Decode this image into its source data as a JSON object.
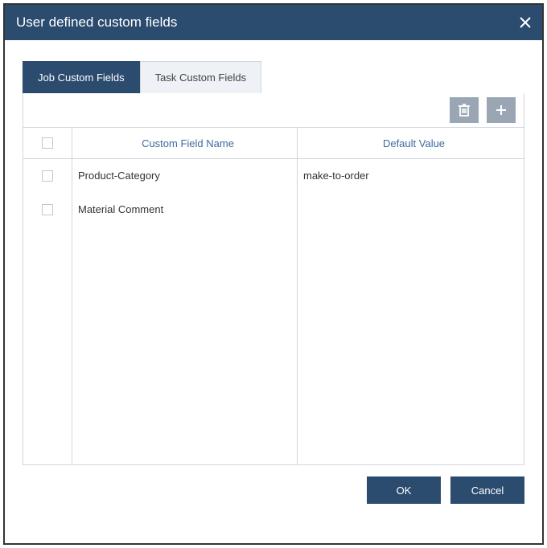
{
  "dialog": {
    "title": "User defined custom fields"
  },
  "tabs": {
    "job": "Job Custom Fields",
    "task": "Task Custom Fields",
    "active": "job"
  },
  "grid": {
    "headers": {
      "name": "Custom Field Name",
      "value": "Default Value"
    },
    "rows": [
      {
        "name": "Product-Category",
        "value": "make-to-order"
      },
      {
        "name": "Material Comment",
        "value": ""
      }
    ]
  },
  "footer": {
    "ok": "OK",
    "cancel": "Cancel"
  }
}
